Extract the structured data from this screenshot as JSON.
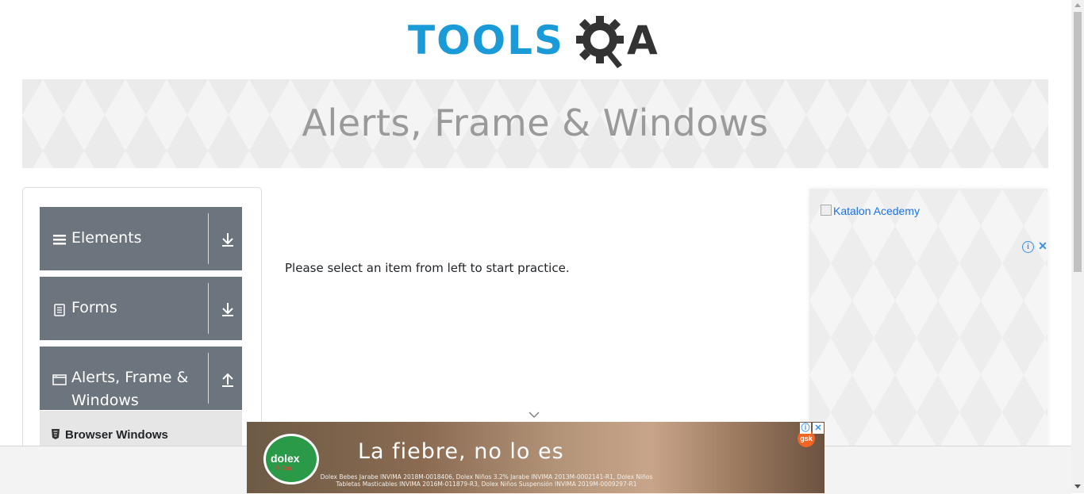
{
  "header": {
    "logo_text_primary": "TOOLS",
    "logo_text_secondary": "A",
    "logo_colors": {
      "primary": "#1a9ad6",
      "secondary": "#333333"
    }
  },
  "banner": {
    "title": "Alerts, Frame & Windows"
  },
  "sidebar": {
    "groups": [
      {
        "label": "Elements",
        "icon": "hamburger-icon",
        "arrow": "download-arrow-icon"
      },
      {
        "label": "Forms",
        "icon": "document-icon",
        "arrow": "download-arrow-icon"
      },
      {
        "label_line1": "Alerts, Frame &",
        "label_line2": "Windows",
        "icon": "window-icon",
        "arrow": "upload-arrow-icon"
      }
    ],
    "sub_items": [
      {
        "label": "Browser Windows",
        "icon": "html-icon"
      }
    ]
  },
  "main": {
    "message": "Please select an item from left to start practice."
  },
  "right_ad": {
    "link_text": "Katalon Acedemy"
  },
  "bottom_ad": {
    "brand": "dolex",
    "brand_sub": "Niños",
    "headline": "La fiebre, no lo es",
    "fine_print": "Dolex Bebes Jarabe INVIMA 2018M-0018406, Dolex Niños 3.2% Jarabe INVIMA 2013M-0002141-R1, Dolex Niños Tabletas Masticables INVIMA 2016M-011879-R3, Dolex Niños Suspensión INVIMA 2019M-0009297-R1",
    "sponsor": "gsk"
  },
  "colors": {
    "sidebar_group_bg": "#6c757d",
    "accent": "#1a9ad6"
  }
}
